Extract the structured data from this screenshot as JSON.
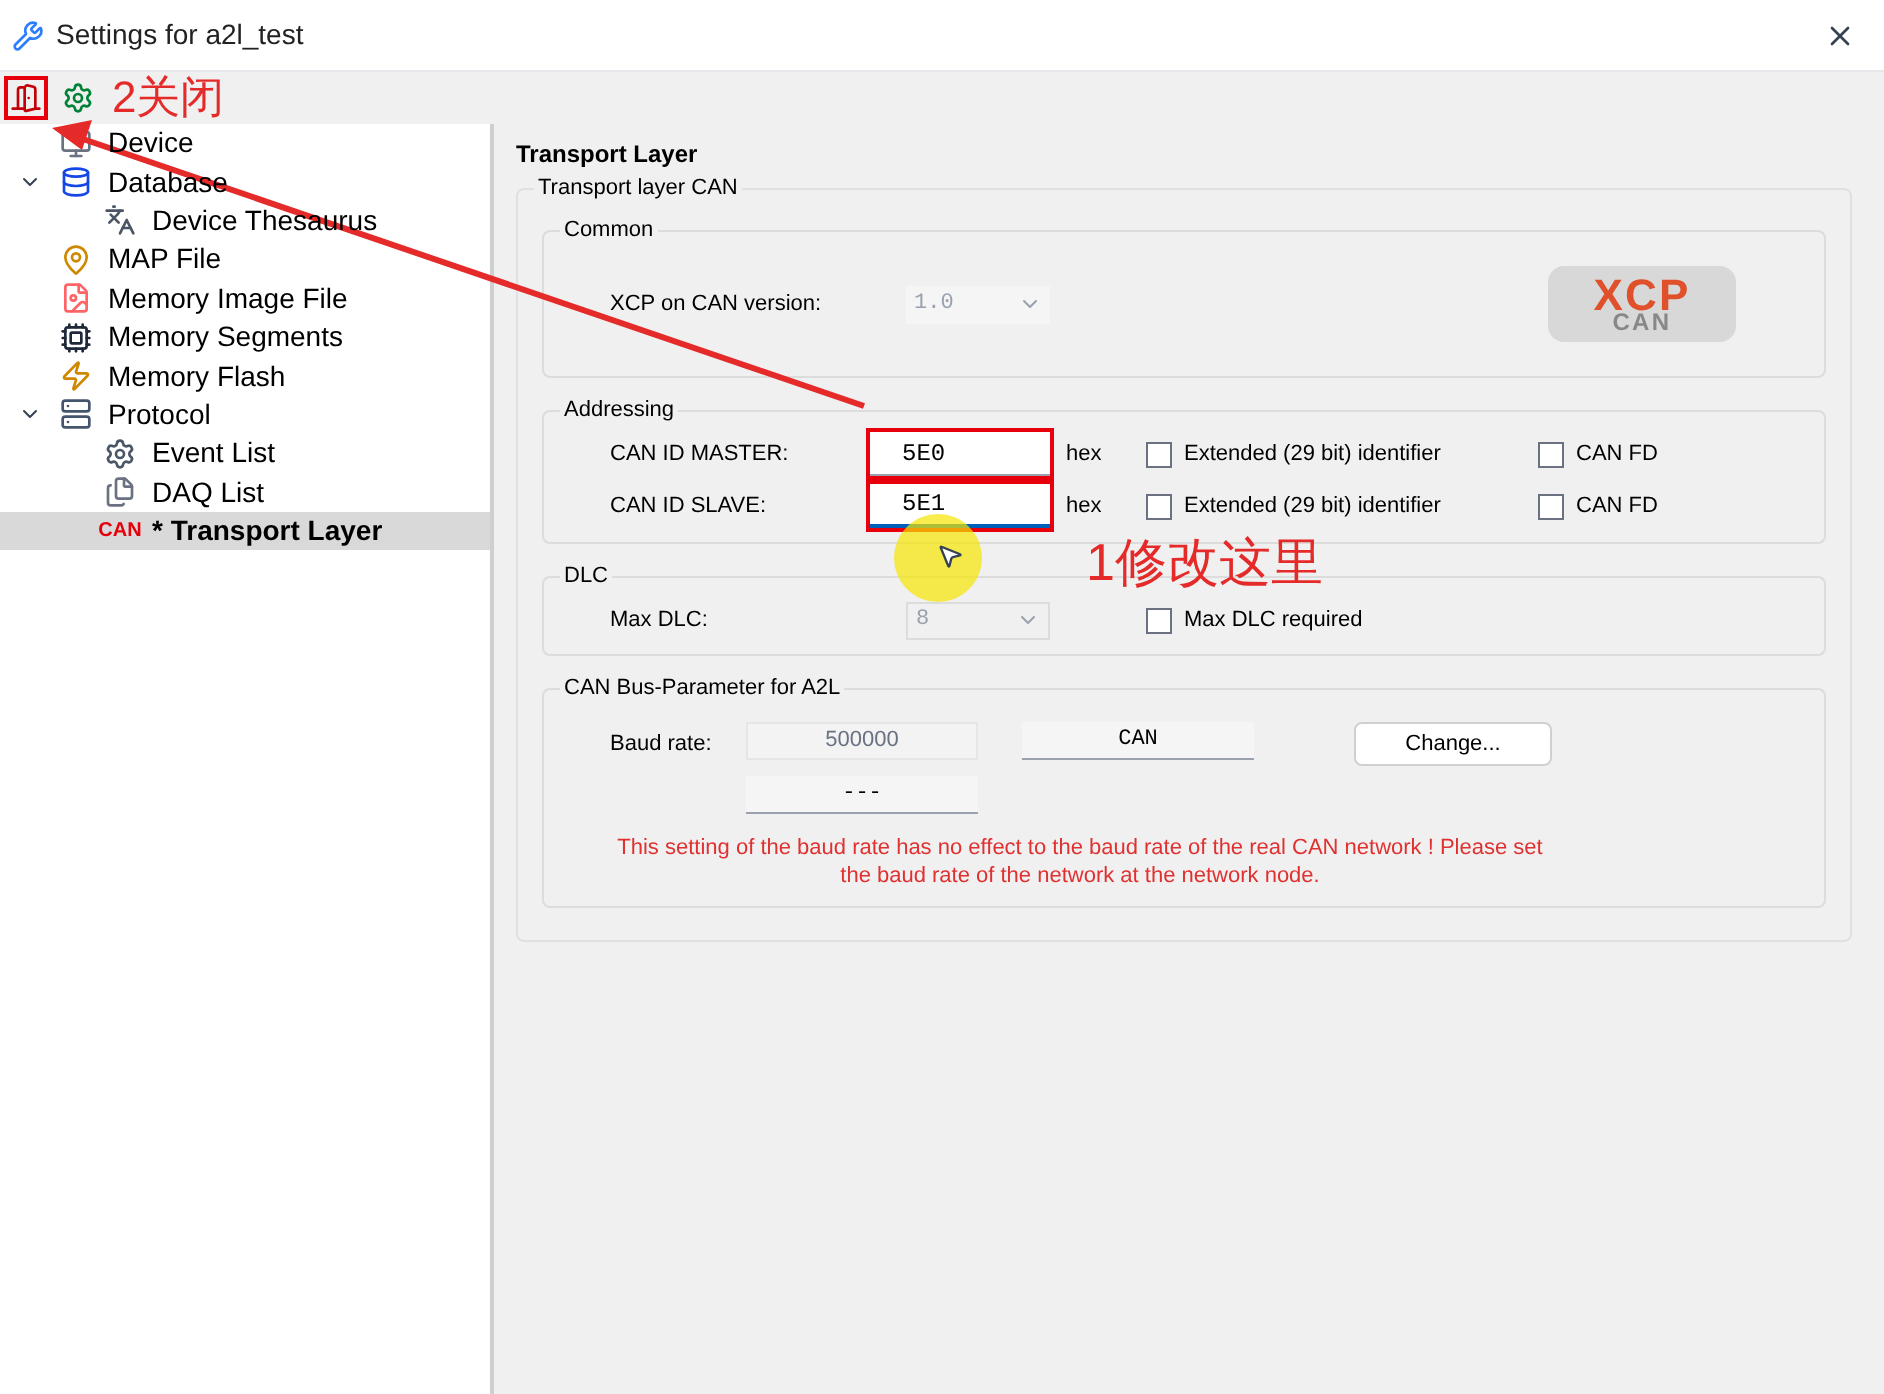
{
  "window": {
    "title": "Settings for a2l_test"
  },
  "toolbar": [
    {
      "kind": "close",
      "highlighted": true
    },
    {
      "kind": "settings",
      "highlighted": false
    }
  ],
  "toolbar_note": "2关闭",
  "tree": [
    {
      "label": "Device",
      "selected": false
    },
    {
      "label": "Database",
      "selected": false,
      "expanded": true,
      "children": [
        {
          "label": "Device Thesaurus",
          "selected": false
        }
      ]
    },
    {
      "label": "MAP File",
      "selected": false
    },
    {
      "label": "Memory Image File",
      "selected": false
    },
    {
      "label": "Memory Segments",
      "selected": false
    },
    {
      "label": "Memory Flash",
      "selected": false
    },
    {
      "label": "Protocol",
      "selected": false,
      "expanded": true,
      "children": [
        {
          "label": "Event List",
          "selected": false
        },
        {
          "label": "DAQ List",
          "selected": false
        },
        {
          "label": "* Transport Layer",
          "icon_text": "CAN",
          "selected": true
        }
      ]
    }
  ],
  "page_title": "Transport Layer",
  "group_title": "Transport layer CAN",
  "common": {
    "title": "Common",
    "version_label": "XCP on CAN version:",
    "version_value": "1.0",
    "version_disabled": true,
    "logo": {
      "top": "XCP",
      "bottom": "CAN"
    }
  },
  "addressing": {
    "title": "Addressing",
    "rows": [
      {
        "label": "CAN ID MASTER:",
        "value": "5E0",
        "focused": false,
        "highlighted": true,
        "unit": "hex",
        "extended_label": "Extended (29 bit) identifier",
        "extended_checked": false,
        "fd_label": "CAN FD",
        "fd_checked": false
      },
      {
        "label": "CAN ID SLAVE:",
        "value": "5E1",
        "focused": true,
        "highlighted": true,
        "unit": "hex",
        "extended_label": "Extended (29 bit) identifier",
        "extended_checked": false,
        "fd_label": "CAN FD",
        "fd_checked": false
      }
    ]
  },
  "field_note": "1修改这里",
  "dlc": {
    "title": "DLC",
    "label": "Max DLC:",
    "value": "8",
    "disabled": true,
    "required_label": "Max DLC required",
    "required_checked": false
  },
  "bus": {
    "title": "CAN Bus-Parameter for A2L",
    "baud_label": "Baud rate:",
    "baud_value": "500000",
    "type_button": "CAN",
    "second_button": "---",
    "change_button": "Change...",
    "warning": "This setting of the baud rate has no effect to the baud rate of the real CAN network ! Please set the baud rate of the network at the network node."
  }
}
